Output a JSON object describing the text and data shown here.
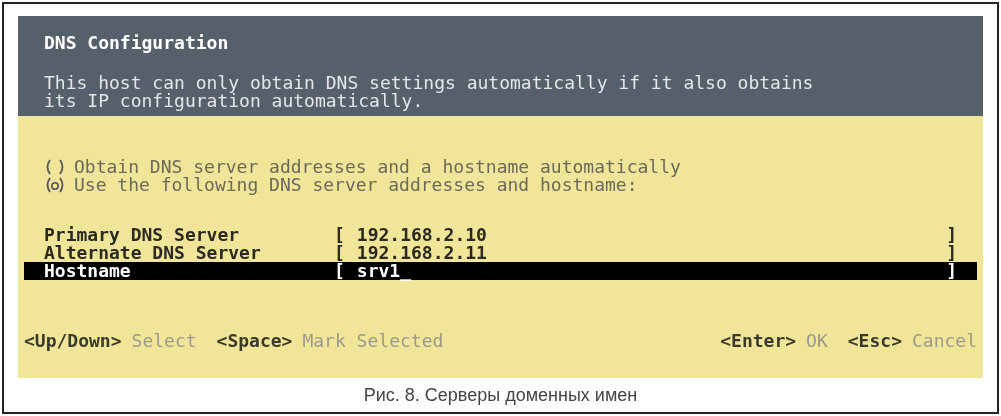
{
  "screen": {
    "title": "DNS Configuration",
    "description": "This host can only obtain DNS settings automatically if it also obtains its IP configuration automatically.",
    "options": [
      {
        "label": "Obtain DNS server addresses and a hostname automatically",
        "selected": false
      },
      {
        "label": "Use the following DNS server addresses and hostname:",
        "selected": true
      }
    ],
    "fields": [
      {
        "label": "Primary DNS Server",
        "open": "[",
        "value": "192.168.2.10",
        "close": "]",
        "selected": false
      },
      {
        "label": "Alternate DNS Server",
        "open": "[",
        "value": "192.168.2.11",
        "close": "]",
        "selected": false
      },
      {
        "label": "Hostname",
        "open": "[",
        "value": "srv1_",
        "close": "]",
        "selected": true
      }
    ],
    "hints_left": [
      {
        "key": "<Up/Down>",
        "action": "Select"
      },
      {
        "key": "<Space>",
        "action": "Mark Selected"
      }
    ],
    "hints_right": [
      {
        "key": "<Enter>",
        "action": "OK"
      },
      {
        "key": "<Esc>",
        "action": "Cancel"
      }
    ]
  },
  "caption": "Рис. 8. Серверы доменных имен"
}
